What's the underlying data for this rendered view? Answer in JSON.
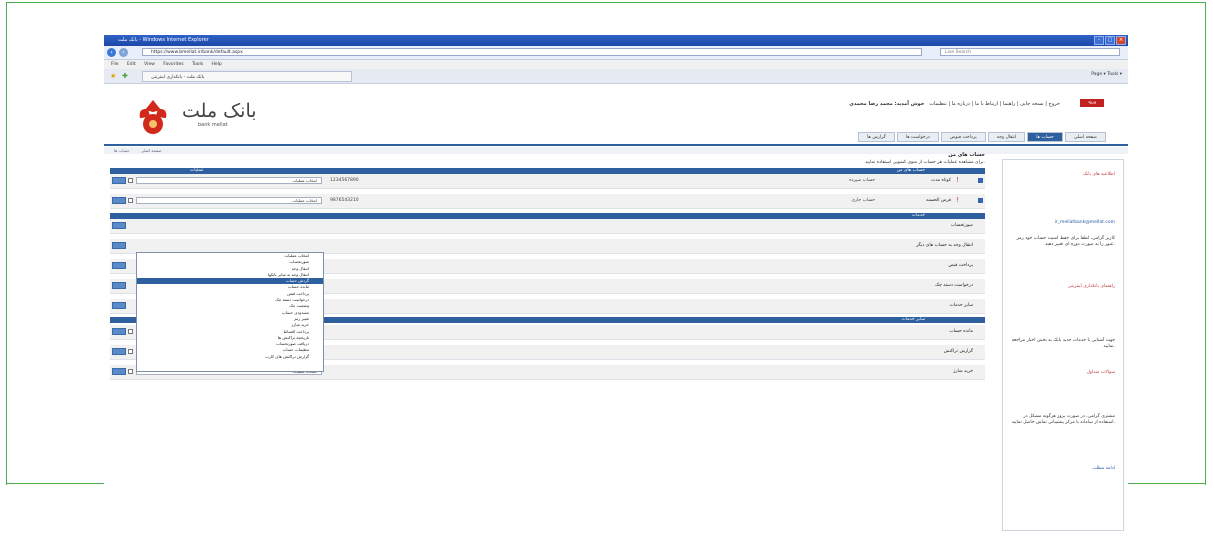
{
  "browser": {
    "title_bar": "بانک ملت - Windows Internet Explorer",
    "url": "https://www.bmellat.ir/bank/default.aspx",
    "search_placeholder": "Live Search",
    "menu": [
      "File",
      "Edit",
      "View",
      "Favorites",
      "Tools",
      "Help"
    ],
    "tab_label": "بانک ملت - بانکداری اینترنتی",
    "tools_text": "Page ▾  Tools ▾"
  },
  "header": {
    "brand_name": "بانک ملت",
    "brand_sub": "bank mellat",
    "top_links": "خروج | نسخه چاپی | راهنما | ارتباط با ما | درباره ما | تنظیمات",
    "welcome": "خوش آمدید: محمد رضا محمدی",
    "login_badge": "ورود",
    "nav_tabs": [
      "صفحه اصلی",
      "حساب ها",
      "انتقال وجه",
      "پرداخت قبوض",
      "درخواست ها",
      "گزارش ها"
    ],
    "breadcrumb": [
      "صفحه اصلی",
      "حساب ها"
    ]
  },
  "sidebar": {
    "items": [
      {
        "text": "اطلاعیه های بانک",
        "style": "lnk"
      },
      {
        "text": "ir_mellatbank@mellat.com",
        "style": "blu"
      },
      {
        "text": "کاربر گرامی، لطفا برای حفظ امنیت حساب خود رمز عبور را به صورت دوره ای تغییر دهید.",
        "style": ""
      },
      {
        "text": "راهنمای بانکداری اینترنتی",
        "style": "lnk"
      },
      {
        "text": "جهت آشنایی با خدمات جدید بانک به بخش اخبار مراجعه نمایید.",
        "style": ""
      },
      {
        "text": "سوالات متداول",
        "style": "lnk"
      },
      {
        "text": "مشتری گرامی، در صورت بروز هرگونه مشکل در استفاده از سامانه با مرکز پشتیبانی تماس حاصل نمایید.",
        "style": ""
      },
      {
        "text": "ادامه مطلب",
        "style": "blu"
      }
    ]
  },
  "main": {
    "title": "حساب های من",
    "note": "برای مشاهده عملیات هر حساب از منوی کشویی استفاده نمایید.",
    "accounts_header": {
      "right": "حساب های من",
      "left": "عملیات"
    },
    "accounts": [
      {
        "type": "کوتاه مدت",
        "name": "حساب سپرده",
        "number": "1234567890"
      },
      {
        "type": "قرض الحسنه",
        "name": "حساب جاری",
        "number": "9876543210"
      }
    ],
    "select_value": "انتخاب عملیات",
    "services_header": "خدمات",
    "services": [
      "صورتحساب",
      "انتقال وجه به حساب های دیگر",
      "پرداخت قبض",
      "درخواست دسته چک",
      "سایر خدمات"
    ],
    "other_header": "سایر خدمات",
    "others": [
      "مانده حساب",
      "گزارش تراکنش",
      "خرید شارژ"
    ],
    "dropdown_options": [
      "انتخاب عملیات",
      "صورتحساب",
      "انتقال وجه",
      "انتقال وجه به سایر بانکها",
      "گردش حساب",
      "مانده حساب",
      "پرداخت قبض",
      "درخواست دسته چک",
      "وضعیت چک",
      "مسدودی حساب",
      "تغییر رمز",
      "خرید شارژ",
      "پرداخت اقساط",
      "تاریخچه تراکنش ها",
      "دریافت صورتحساب",
      "تنظیمات حساب",
      "گزارش تراکنش های کارت"
    ],
    "dropdown_highlight_index": 4
  }
}
